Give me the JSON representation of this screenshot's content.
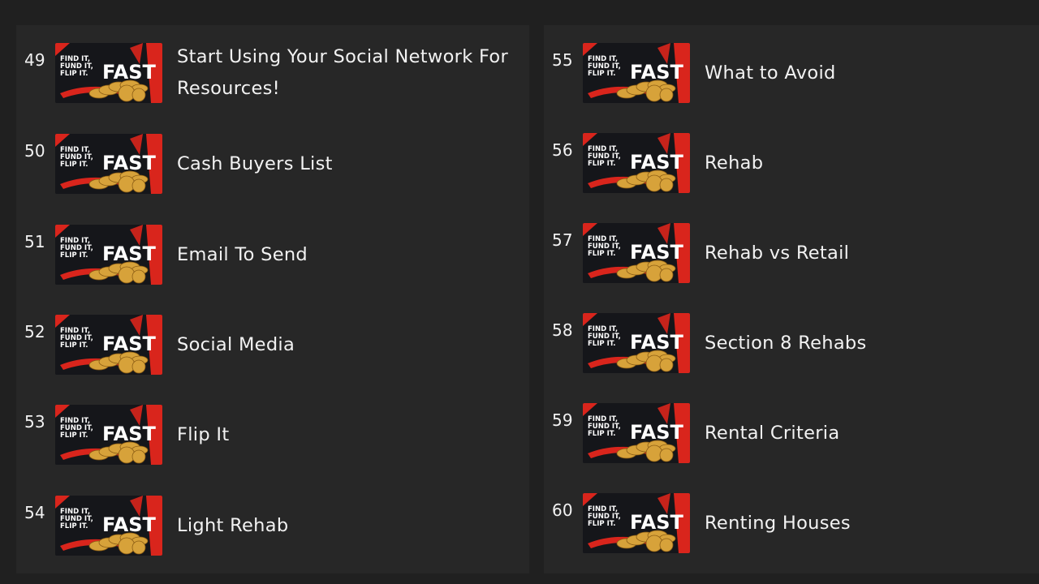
{
  "thumbnail": {
    "line1": "FIND IT,",
    "line2": "FUND IT,",
    "line3": "FLIP IT.",
    "big": "FAST",
    "accent_color": "#d9251c",
    "coin_color": "#d7a23a",
    "background_color": "#15161a"
  },
  "lessons": [
    {
      "number": "49",
      "title": "Start Using Your Social Network For Resources!"
    },
    {
      "number": "50",
      "title": "Cash Buyers List"
    },
    {
      "number": "51",
      "title": "Email To Send"
    },
    {
      "number": "52",
      "title": "Social Media"
    },
    {
      "number": "53",
      "title": "Flip It"
    },
    {
      "number": "54",
      "title": "Light Rehab"
    },
    {
      "number": "55",
      "title": "What to Avoid"
    },
    {
      "number": "56",
      "title": "Rehab"
    },
    {
      "number": "57",
      "title": "Rehab vs Retail"
    },
    {
      "number": "58",
      "title": "Section 8 Rehabs"
    },
    {
      "number": "59",
      "title": "Rental Criteria"
    },
    {
      "number": "60",
      "title": "Renting Houses"
    }
  ]
}
